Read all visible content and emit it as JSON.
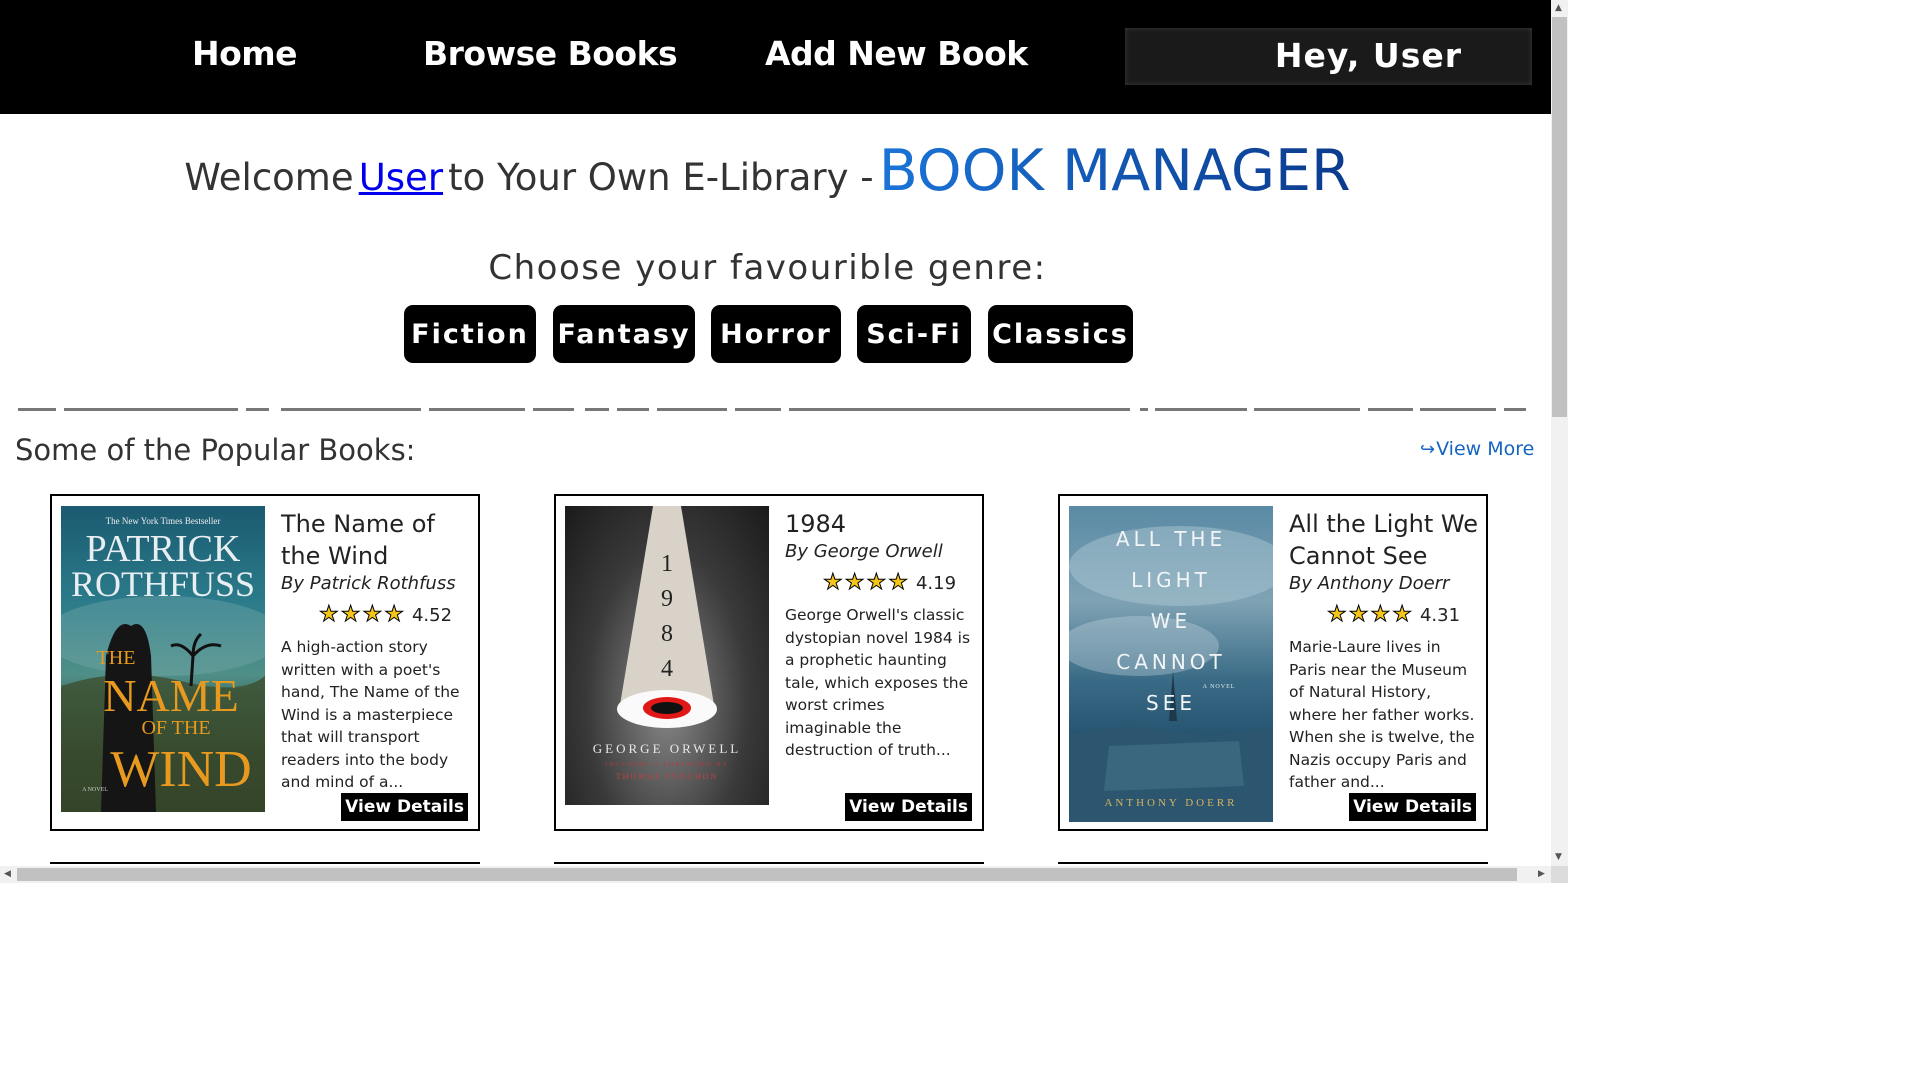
{
  "nav": {
    "home": "Home",
    "browse": "Browse Books",
    "add": "Add New Book",
    "greeting": "Hey, User"
  },
  "welcome": {
    "prefix": "Welcome",
    "user": "User",
    "middle": "to Your Own E-Library -",
    "brand": "BOOK MANAGER"
  },
  "genre": {
    "title": "Choose your favourible genre:",
    "buttons": [
      "Fiction",
      "Fantasy",
      "Horror",
      "Sci-Fi",
      "Classics"
    ]
  },
  "popular": {
    "title": "Some of the Popular Books:",
    "view_more": "View More"
  },
  "books": [
    {
      "title": "The Name of the Wind",
      "author": "By Patrick Rothfuss",
      "rating": "4.52",
      "stars": 4,
      "desc": "A high-action story written with a poet's hand, The Name of the Wind is a masterpiece that will transport readers into the body and mind of a...",
      "button": "View Details",
      "cover": {
        "top_note": "The New York Times Bestseller",
        "author_line1": "PATRICK",
        "author_line2": "ROTHFUSS",
        "title_the": "THE",
        "title_name": "NAME",
        "title_of": "OF THE",
        "title_wind": "WIND",
        "side": "A NOVEL"
      }
    },
    {
      "title": "1984",
      "author": "By George Orwell",
      "rating": "4.19",
      "stars": 4,
      "desc": "George Orwell's classic dystopian novel 1984 is a prophetic haunting tale, which exposes the worst crimes imaginable the destruction of truth...",
      "button": "View Details",
      "cover": {
        "digits": [
          "1",
          "9",
          "8",
          "4"
        ],
        "author": "GEORGE ORWELL",
        "foreword": "INCLUDES A FOREWORD BY",
        "foreword_author": "THOMAS PYNCHON"
      }
    },
    {
      "title": "All the Light We Cannot See",
      "author": "By Anthony Doerr",
      "rating": "4.31",
      "stars": 4,
      "desc": "Marie-Laure lives in Paris near the Museum of Natural History, where her father works. When she is twelve, the Nazis occupy Paris and father and...",
      "button": "View Details",
      "cover": {
        "lines": [
          "ALL THE",
          "LIGHT",
          "WE",
          "CANNOT",
          "SEE"
        ],
        "side": "A NOVEL",
        "author": "ANTHONY DOERR"
      }
    }
  ],
  "colors": {
    "nav_bg": "#000000",
    "brand_start": "#1a74d8",
    "brand_end": "#0b3a8c",
    "link": "#0000ee",
    "view_more": "#1565c0",
    "star": "#f5c518"
  },
  "icons": {
    "view_more": "redo-arrow-icon",
    "rating": "star-icon"
  }
}
